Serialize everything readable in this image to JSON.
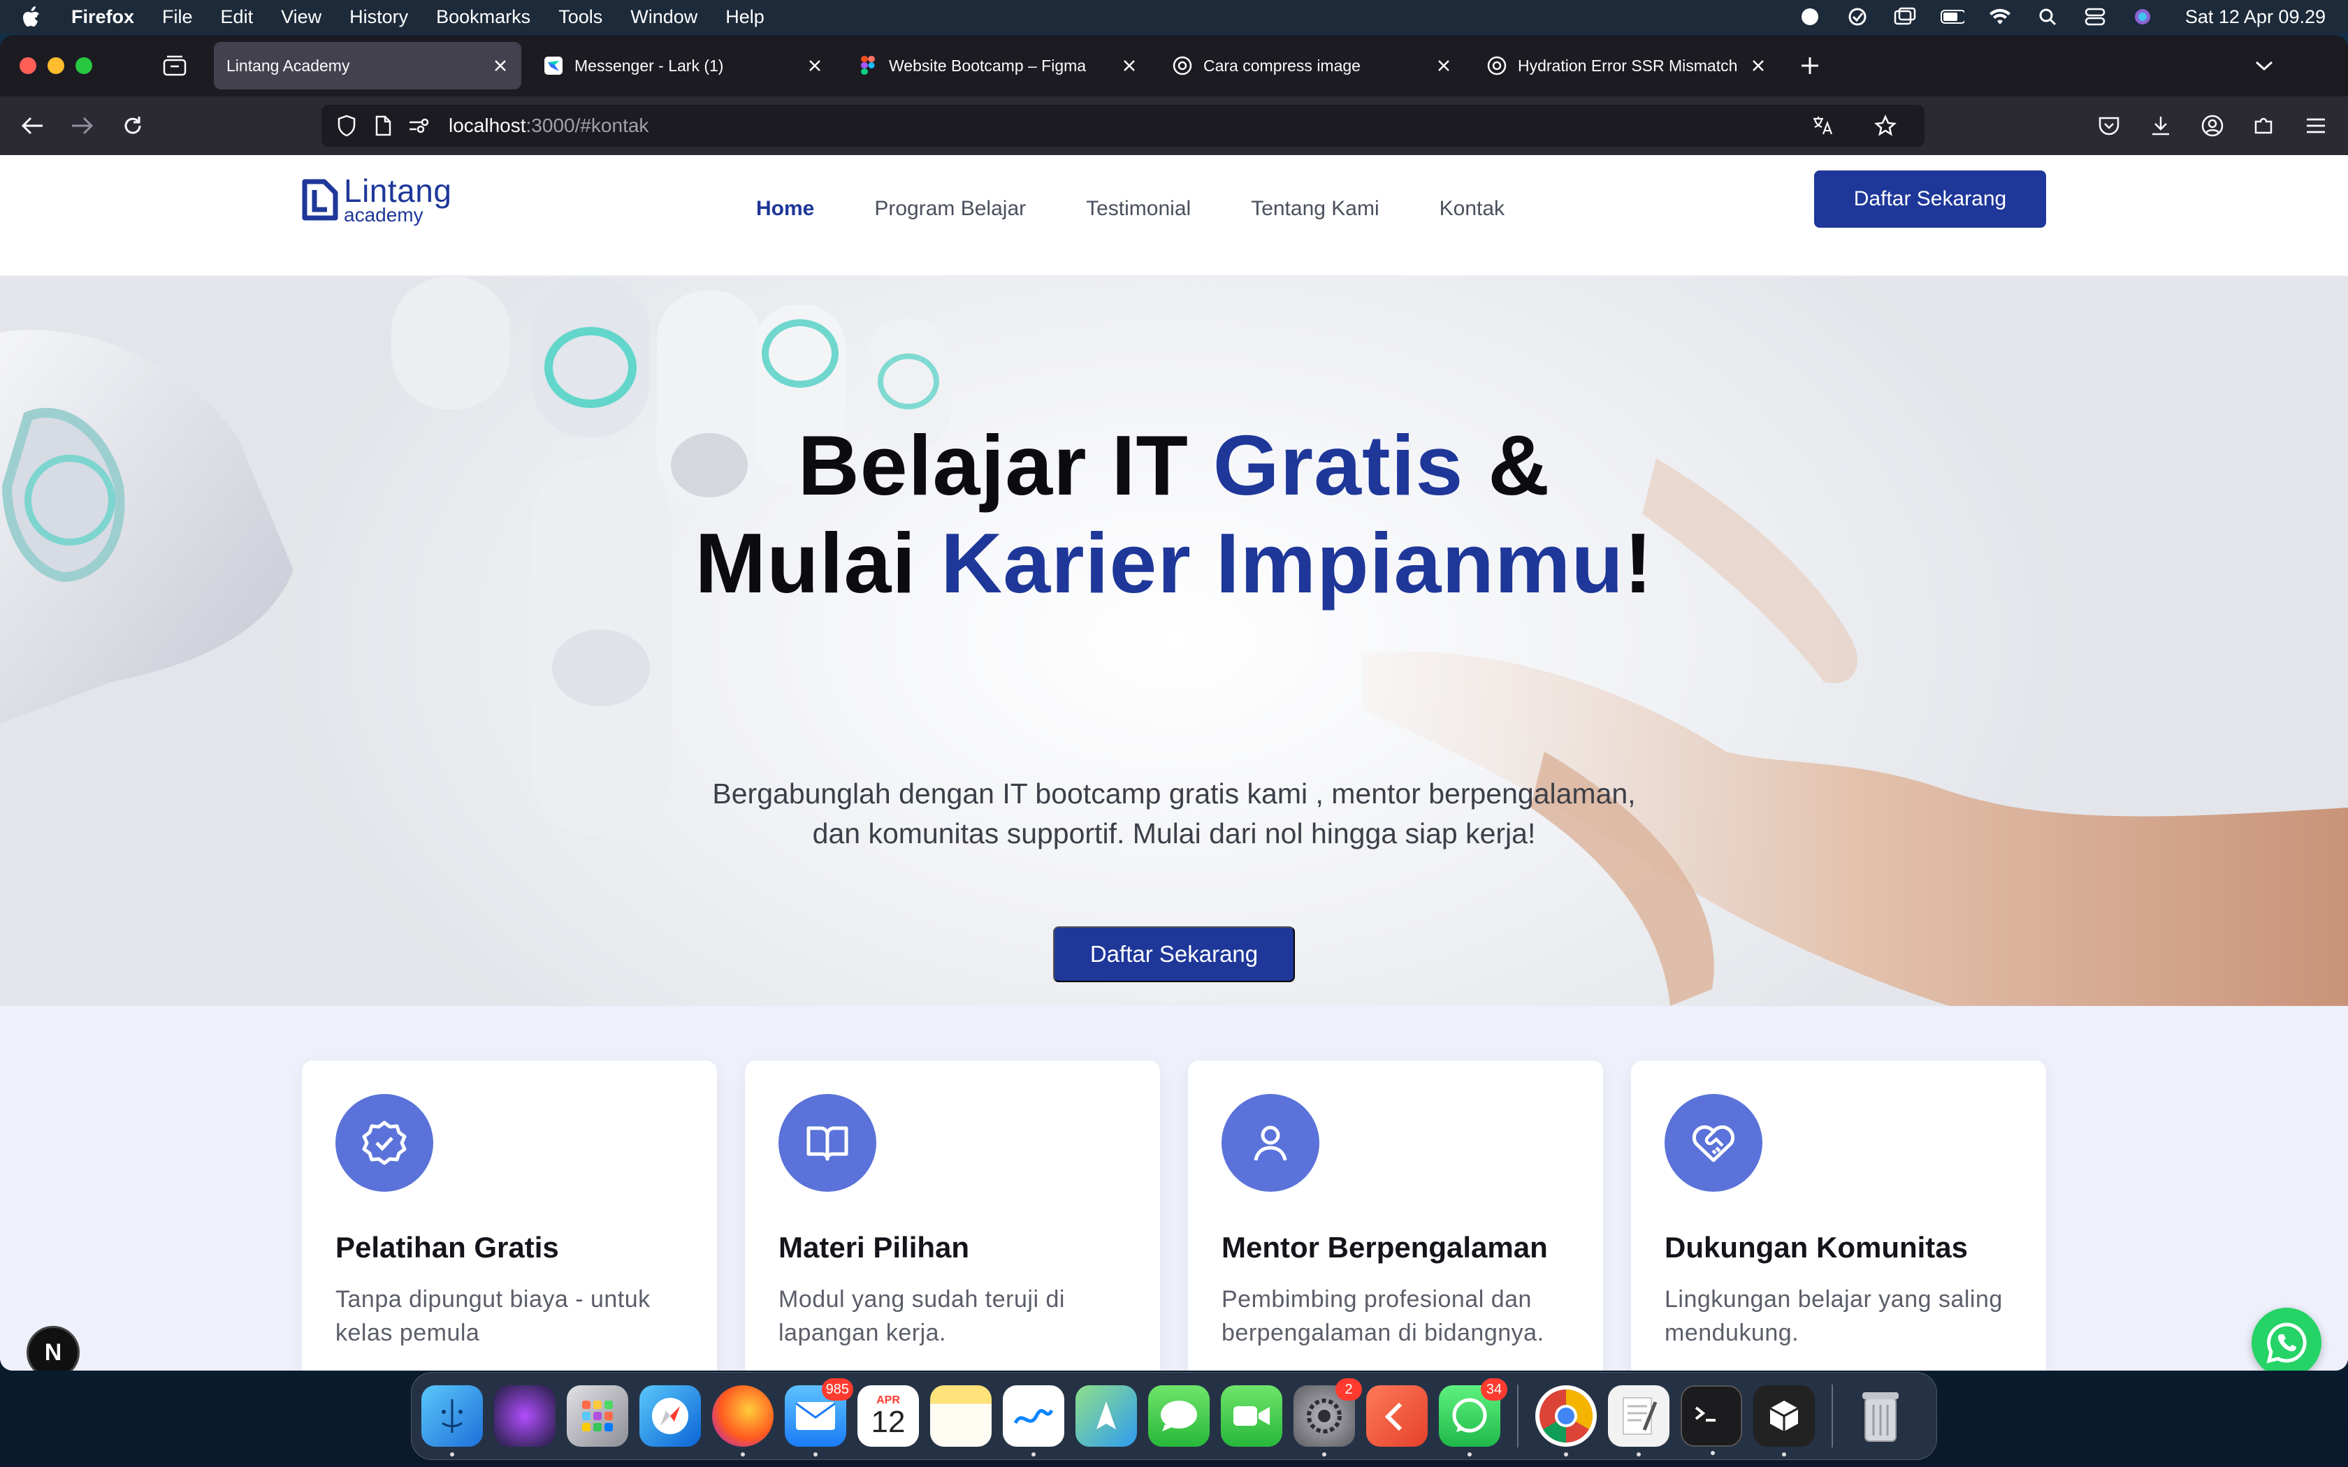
{
  "menubar": {
    "app": "Firefox",
    "items": [
      "File",
      "Edit",
      "View",
      "History",
      "Bookmarks",
      "Tools",
      "Window",
      "Help"
    ],
    "clock": "Sat 12 Apr  09.29"
  },
  "browser": {
    "tabs": [
      {
        "title": "Lintang Academy",
        "active": true
      },
      {
        "title": "Messenger - Lark (1)",
        "active": false
      },
      {
        "title": "Website Bootcamp – Figma",
        "active": false
      },
      {
        "title": "Cara compress image",
        "active": false
      },
      {
        "title": "Hydration Error SSR Mismatch",
        "active": false
      }
    ],
    "url_host": "localhost",
    "url_path": ":3000/#kontak"
  },
  "site": {
    "logo_word": "Lintang",
    "logo_sub": "academy",
    "nav": [
      "Home",
      "Program Belajar",
      "Testimonial",
      "Tentang Kami",
      "Kontak"
    ],
    "nav_cta": "Daftar Sekarang"
  },
  "hero": {
    "title_1a": "Belajar IT ",
    "title_1b": "Gratis",
    "title_1c": " &",
    "title_2a": "Mulai ",
    "title_2b": "Karier Impianmu",
    "title_2c": "!",
    "subtitle": "Bergabunglah dengan IT bootcamp gratis kami , mentor berpengalaman, dan komunitas supportif. Mulai dari nol hingga siap kerja!",
    "cta": "Daftar Sekarang"
  },
  "features": [
    {
      "icon": "badge-check-icon",
      "title": "Pelatihan Gratis",
      "desc": "Tanpa dipungut biaya - untuk kelas pemula"
    },
    {
      "icon": "book-open-icon",
      "title": "Materi Pilihan",
      "desc": "Modul yang sudah teruji di lapangan kerja."
    },
    {
      "icon": "user-icon",
      "title": "Mentor Berpengalaman",
      "desc": "Pembimbing profesional dan berpengalaman di bidangnya."
    },
    {
      "icon": "heart-handshake-icon",
      "title": "Dukungan Komunitas",
      "desc": "Lingkungan belajar yang saling mendukung."
    }
  ],
  "floating": {
    "next_badge": "N"
  },
  "dock": {
    "mail_badge": "985",
    "calendar_month": "APR",
    "calendar_day": "12",
    "settings_badge": "2",
    "whatsapp_badge": "34"
  },
  "colors": {
    "brand": "#1e3799",
    "feature_icon_bg": "#5a72d9",
    "features_bg": "#eef0fb",
    "whatsapp": "#25d366"
  }
}
